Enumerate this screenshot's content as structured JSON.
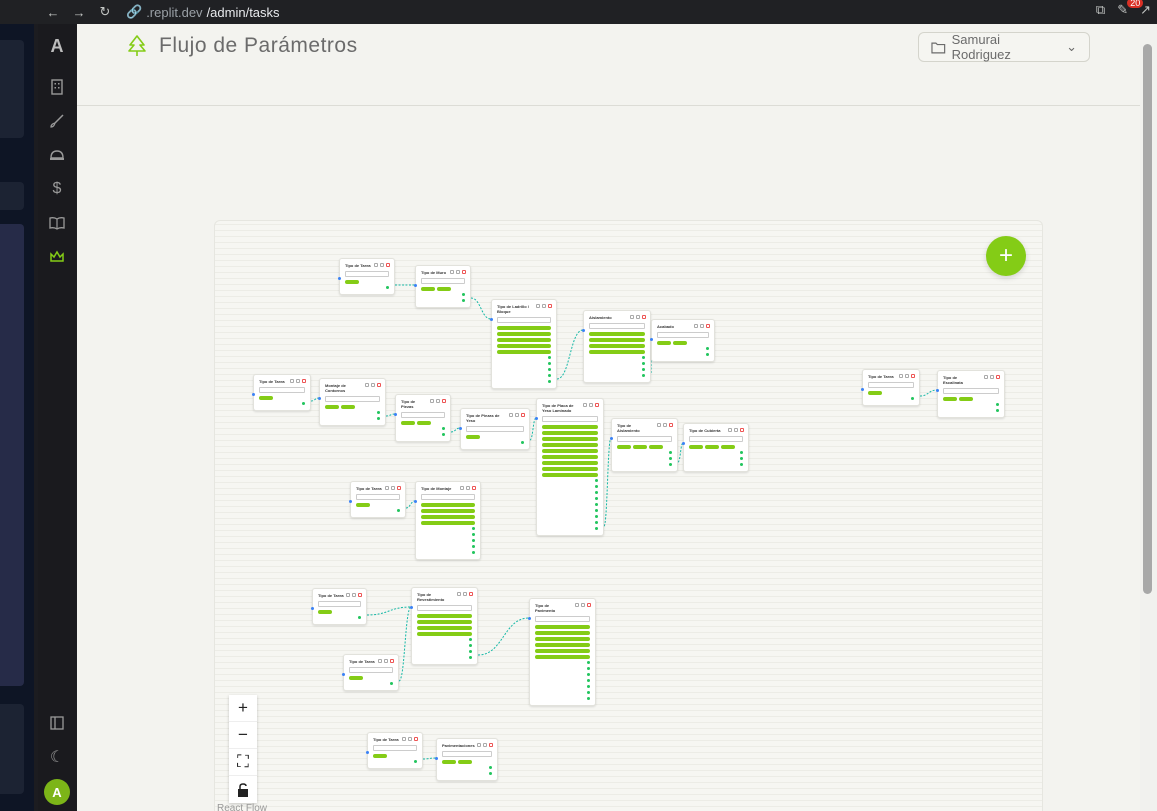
{
  "browser": {
    "url_host": ".replit.dev",
    "url_path": "/admin/tasks",
    "badge_count": "20"
  },
  "sidebar": {
    "logo": "A",
    "avatar_initial": "A",
    "icons": [
      "building-icon",
      "brush-icon",
      "hardhat-icon",
      "dollar-icon",
      "book-icon",
      "crown-icon"
    ]
  },
  "header": {
    "title": "Flujo de Parámetros",
    "user": "Samurai Rodriguez"
  },
  "canvas": {
    "add_label": "+",
    "zoom_in": "+",
    "zoom_out": "−",
    "fit": "⛶",
    "lock": "🔒",
    "attribution": "React Flow"
  },
  "colors": {
    "accent": "#84cc16",
    "handle_out": "#22c55e",
    "handle_in": "#3b82f6"
  },
  "nodes": [
    {
      "title": "Tipo de Tarea",
      "pills": 1,
      "rows": 1
    },
    {
      "title": "Tipo de Muro",
      "pills": 2,
      "rows": 2
    },
    {
      "title": "Tipo de Ladrillo / Bloque",
      "pills": 5,
      "rows": 5
    },
    {
      "title": "Aislamiento",
      "pills": 4,
      "rows": 4
    },
    {
      "title": "Acabado",
      "pills": 2,
      "rows": 2
    },
    {
      "title": "Tipo de Tarea",
      "pills": 1,
      "rows": 1
    },
    {
      "title": "Tipo de Escalinata",
      "pills": 2,
      "rows": 2
    },
    {
      "title": "Tipo de Tarea",
      "pills": 1,
      "rows": 1
    },
    {
      "title": "Montaje de Contornos",
      "pills": 2,
      "rows": 2
    },
    {
      "title": "Tipo de Piezas",
      "pills": 2,
      "rows": 2
    },
    {
      "title": "Tipo de Piezas de Yeso",
      "pills": 1,
      "rows": 1
    },
    {
      "title": "Tipo de Placa de Yeso Laminado",
      "pills": 9,
      "rows": 9
    },
    {
      "title": "Tipo de Aislamiento",
      "pills": 3,
      "rows": 3
    },
    {
      "title": "Tipo de Cubierta",
      "pills": 3,
      "rows": 3
    },
    {
      "title": "Tipo de Tarea",
      "pills": 1,
      "rows": 1
    },
    {
      "title": "Tipo de Montaje",
      "pills": 4,
      "rows": 5
    },
    {
      "title": "Tipo de Tarea",
      "pills": 1,
      "rows": 1
    },
    {
      "title": "Tipo de Revestimiento",
      "pills": 4,
      "rows": 4
    },
    {
      "title": "Tipo de Pavimento",
      "pills": 6,
      "rows": 7
    },
    {
      "title": "Tipo de Tarea",
      "pills": 1,
      "rows": 1
    },
    {
      "title": "Tipo de Tarea",
      "pills": 1,
      "rows": 1
    },
    {
      "title": "Pavimentaciones",
      "pills": 2,
      "rows": 2
    }
  ]
}
